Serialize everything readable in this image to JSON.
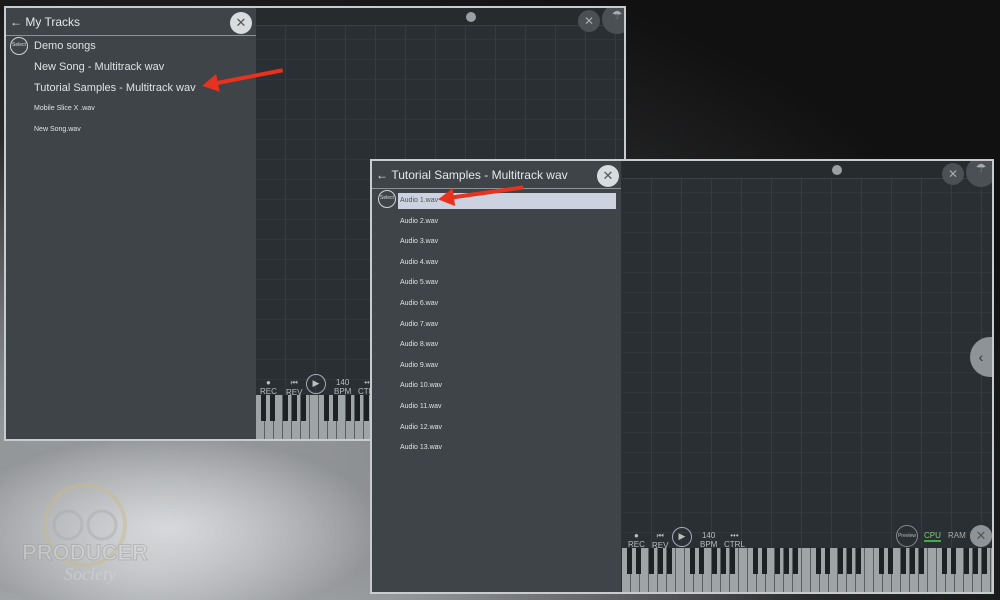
{
  "window1": {
    "title": "My Tracks",
    "back_icon": "arrow-left-icon",
    "close_icon": "close-icon",
    "select_label": "Select",
    "items": [
      "Demo songs",
      "New Song - Multitrack wav",
      "Tutorial Samples  - Multitrack wav",
      "Mobile Slice X .wav",
      "New Song.wav"
    ],
    "transport": {
      "rec": "REC",
      "prev": "REV",
      "tempo": "140",
      "tempo_label": "BPM",
      "more": "•••",
      "more_label": "CTRL"
    }
  },
  "window2": {
    "title": "Tutorial Samples  - Multitrack wav",
    "select_label": "Select",
    "selected_index": 0,
    "items": [
      "Audio 1.wav",
      "Audio 2.wav",
      "Audio 3.wav",
      "Audio 4.wav",
      "Audio 5.wav",
      "Audio 6.wav",
      "Audio 7.wav",
      "Audio 8.wav",
      "Audio 9.wav",
      "Audio 10.wav",
      "Audio 11.wav",
      "Audio 12.wav",
      "Audio 13.wav"
    ],
    "transport": {
      "rec": "REC",
      "prev": "REV",
      "tempo": "140",
      "tempo_label": "BPM",
      "more": "•••",
      "more_label": "CTRL",
      "preview": "Preview",
      "cpu": "CPU",
      "ram": "RAM"
    }
  },
  "colors": {
    "annotation_arrow": "#e8321e",
    "highlight": "#cdd2e0",
    "cpu_meter": "#3fae49"
  },
  "watermark": "PRODUCER Society"
}
